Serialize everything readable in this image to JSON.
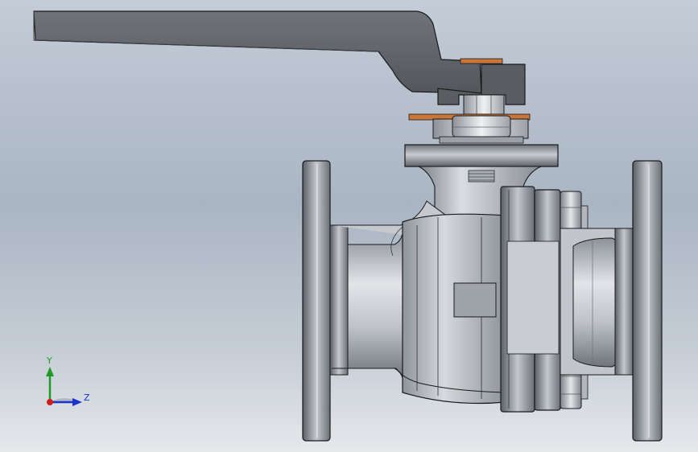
{
  "viewport": {
    "background_top": "#c3ccd7",
    "background_bottom": "#e6e8ec"
  },
  "model": {
    "parts": [
      "handle",
      "stem-nut",
      "packing-washer",
      "bonnet-flange",
      "valve-body",
      "end-cap",
      "left-flange",
      "right-flange",
      "body-bolts"
    ],
    "colors": {
      "handle": "#5f6266",
      "steel": "#b8bcc4",
      "washer": "#c8763a",
      "outline": "#1a1a1a"
    }
  },
  "triad": {
    "y_label": "Y",
    "z_label": "Z",
    "colors": {
      "y": "#1f9a2a",
      "z": "#1b33c8",
      "x": "#d01e1e"
    }
  }
}
